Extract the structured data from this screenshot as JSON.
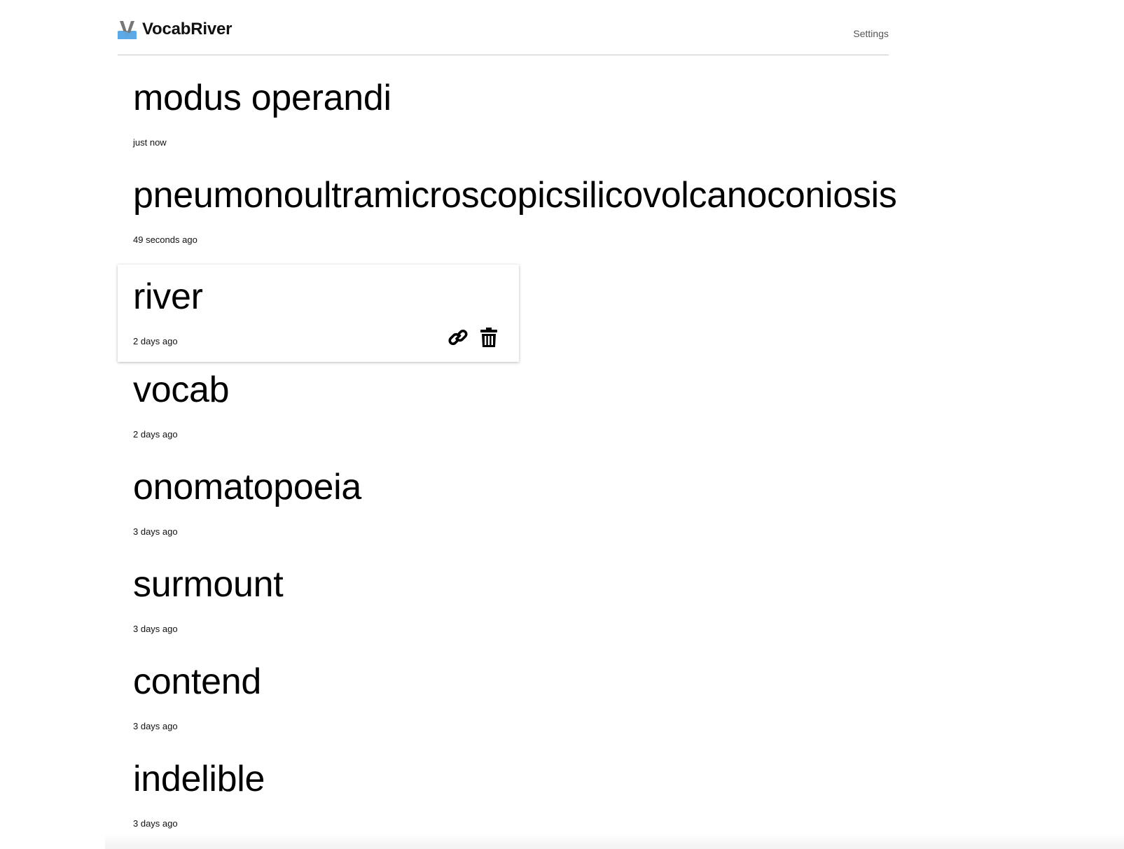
{
  "header": {
    "app_name": "VocabRiver",
    "settings_label": "Settings",
    "logo_icon": "v-river-logo-icon",
    "logo_colors": {
      "letter": "#777777",
      "water": "#5ba8e6"
    }
  },
  "words": [
    {
      "term": "modus operandi",
      "time": "just now"
    },
    {
      "term": "pneumonoultramicroscopicsilicovolcanoconiosis",
      "time": "49 seconds ago"
    },
    {
      "term": "river",
      "time": "2 days ago",
      "hovered": true,
      "actions": [
        "link-icon",
        "trash-icon"
      ]
    },
    {
      "term": "vocab",
      "time": "2 days ago"
    },
    {
      "term": "onomatopoeia",
      "time": "3 days ago"
    },
    {
      "term": "surmount",
      "time": "3 days ago"
    },
    {
      "term": "contend",
      "time": "3 days ago"
    },
    {
      "term": "indelible",
      "time": "3 days ago"
    }
  ]
}
